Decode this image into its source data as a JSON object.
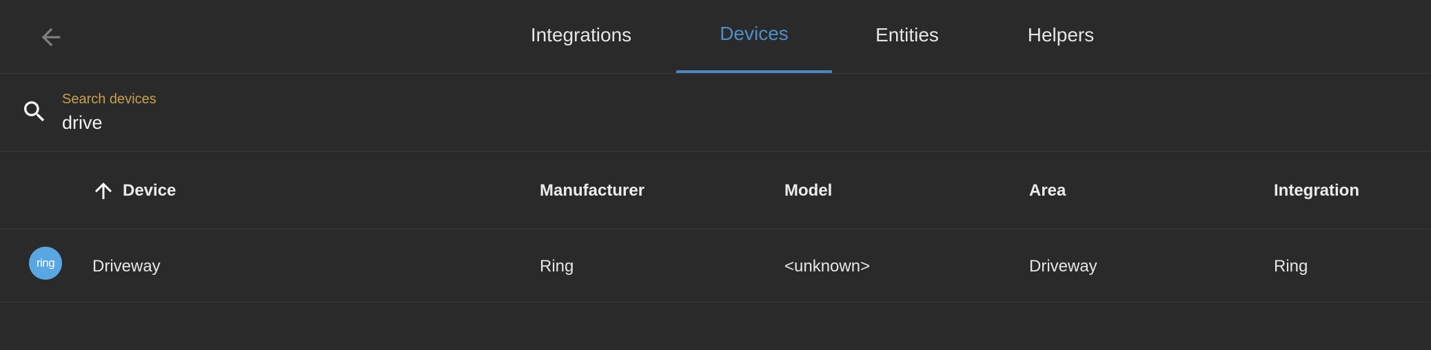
{
  "header": {
    "tabs": [
      {
        "label": "Integrations",
        "active": false
      },
      {
        "label": "Devices",
        "active": true
      },
      {
        "label": "Entities",
        "active": false
      },
      {
        "label": "Helpers",
        "active": false
      }
    ]
  },
  "search": {
    "label": "Search devices",
    "value": "drive"
  },
  "table": {
    "columns": [
      "Device",
      "Manufacturer",
      "Model",
      "Area",
      "Integration"
    ],
    "sort": {
      "column": "Device",
      "direction": "ascending"
    },
    "rows": [
      {
        "logo_text": "ring",
        "device": "Driveway",
        "manufacturer": "Ring",
        "model": "<unknown>",
        "area": "Driveway",
        "integration": "Ring"
      }
    ]
  },
  "colors": {
    "background": "#2a2a2a",
    "accent": "#4a86c5",
    "search_label": "#c7a14a",
    "ring_logo": "#58a7e2"
  },
  "icons": [
    "back-arrow-icon",
    "search-icon",
    "sort-ascending-icon",
    "ring-logo"
  ]
}
